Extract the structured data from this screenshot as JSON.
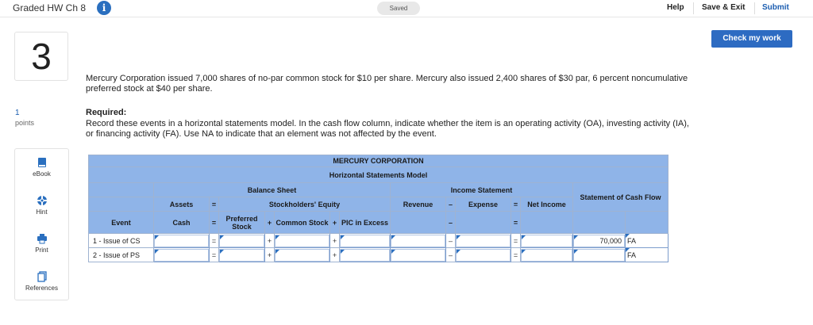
{
  "header": {
    "title": "Graded HW Ch 8",
    "saved": "Saved",
    "help": "Help",
    "save_exit": "Save & Exit",
    "submit": "Submit",
    "check_work": "Check my work"
  },
  "question": {
    "number": "3",
    "points_value": "1",
    "points_label": "points",
    "text": "Mercury Corporation issued 7,000 shares of no-par common stock for $10 per share. Mercury also issued 2,400 shares of $30 par, 6 percent noncumulative preferred stock at $40 per share.",
    "required_heading": "Required:",
    "required_text": "Record these events in a horizontal statements model. In the cash flow column, indicate whether the item is an operating activity (OA), investing activity (IA), or financing activity (FA). Use NA to indicate that an element was not affected by the event."
  },
  "tools": [
    {
      "label": "eBook",
      "icon": "book-icon"
    },
    {
      "label": "Hint",
      "icon": "lifebuoy-icon"
    },
    {
      "label": "Print",
      "icon": "printer-icon"
    },
    {
      "label": "References",
      "icon": "documents-icon"
    }
  ],
  "table": {
    "company": "MERCURY CORPORATION",
    "model": "Horizontal Statements Model",
    "balance_sheet": "Balance Sheet",
    "income_statement": "Income Statement",
    "cash_flow": "Statement of Cash Flow",
    "assets": "Assets",
    "equity": "Stockholders' Equity",
    "event": "Event",
    "cash": "Cash",
    "preferred": "Preferred Stock",
    "common": "Common Stock",
    "pic": "PIC in Excess",
    "revenue": "Revenue",
    "expense": "Expense",
    "net_income": "Net Income",
    "op_eq": "=",
    "op_plus": "+",
    "op_minus": "–",
    "rows": [
      {
        "event": "1 - Issue of CS",
        "cash": "",
        "preferred": "",
        "common": "",
        "pic": "",
        "revenue": "",
        "expense": "",
        "net_income": "",
        "cf_amount": "70,000",
        "cf_type": "FA"
      },
      {
        "event": "2 - Issue of PS",
        "cash": "",
        "preferred": "",
        "common": "",
        "pic": "",
        "revenue": "",
        "expense": "",
        "net_income": "",
        "cf_amount": "",
        "cf_type": "FA"
      }
    ]
  }
}
